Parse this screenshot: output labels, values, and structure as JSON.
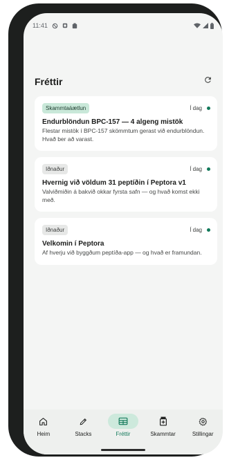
{
  "status_bar": {
    "time": "11:41",
    "left_icons": [
      "do-not-disturb-icon",
      "notification-icon",
      "clipboard-icon"
    ],
    "right_icons": [
      "wifi-icon",
      "signal-icon",
      "battery-icon"
    ]
  },
  "app_bar": {
    "title": "Fréttir",
    "refresh_icon": "refresh-icon"
  },
  "news": [
    {
      "tag": "Skammtaáætlun",
      "tag_style": "green",
      "date": "Í dag",
      "unread": true,
      "title": "Endurblöndun BPC-157 — 4 algeng mistök",
      "summary": "Flestar mistök í BPC-157 skömmtum gerast við endurblöndun. Hvað ber að varast."
    },
    {
      "tag": "Iðnaður",
      "tag_style": "gray",
      "date": "Í dag",
      "unread": true,
      "title": "Hvernig við völdum 31 peptíðin í Peptora v1",
      "summary": "Valviðmiðin á bakvið okkar fyrsta safn — og hvað komst ekki með."
    },
    {
      "tag": "Iðnaður",
      "tag_style": "gray",
      "date": "Í dag",
      "unread": true,
      "title": "Velkomin í Peptora",
      "summary": "Af hverju við byggðum peptíða-app — og hvað er framundan."
    }
  ],
  "nav": {
    "items": [
      {
        "label": "Heim",
        "icon": "home-icon",
        "active": false
      },
      {
        "label": "Stacks",
        "icon": "pencil-icon",
        "active": false
      },
      {
        "label": "Fréttir",
        "icon": "news-icon",
        "active": true
      },
      {
        "label": "Skammtar",
        "icon": "medication-icon",
        "active": false
      },
      {
        "label": "Stillingar",
        "icon": "gear-icon",
        "active": false
      }
    ]
  },
  "colors": {
    "accent": "#12795a",
    "tag_green_bg": "#c9e8d9",
    "nav_active_bg": "#cde9dc",
    "background": "#f4f5f4"
  }
}
